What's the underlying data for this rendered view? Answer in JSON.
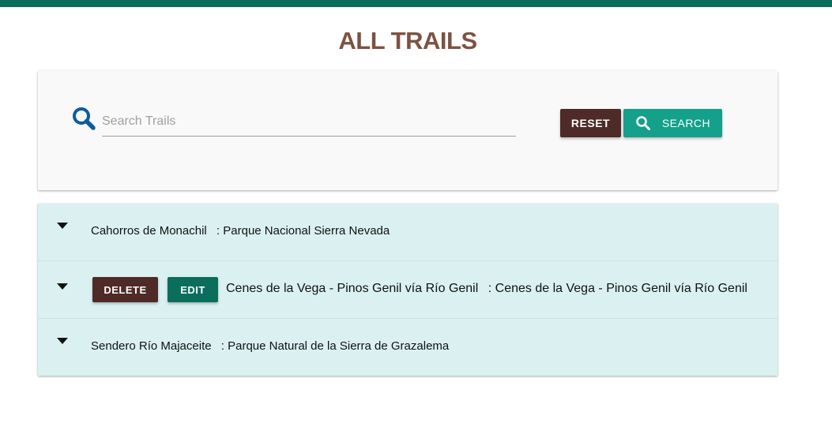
{
  "page": {
    "title": "ALL TRAILS",
    "colors": {
      "topbar": "#0b6e5c",
      "title": "#7d5242",
      "reset_button": "#4e2b26",
      "search_button": "#14a08a",
      "delete_button": "#4e2b26",
      "edit_button": "#0b6e5c",
      "list_background": "#dbf1f1",
      "search_icon": "#0d5c9e"
    }
  },
  "search": {
    "icon": "search-icon",
    "placeholder": "Search Trails",
    "value": "",
    "reset_label": "RESET",
    "search_label": "SEARCH",
    "search_button_icon": "search-icon"
  },
  "trails": [
    {
      "name": "Cahorros de Monachil",
      "separator": ":",
      "location": "Parque Nacional Sierra Nevada",
      "expand_icon": "caret-down-icon",
      "actions_visible": false
    },
    {
      "name": "Cenes de la Vega - Pinos Genil vía Río Genil",
      "separator": ":",
      "location": "Cenes de la Vega - Pinos Genil vía Río Genil",
      "expand_icon": "caret-down-icon",
      "actions_visible": true,
      "delete_label": "DELETE",
      "edit_label": "EDIT"
    },
    {
      "name": "Sendero Río Majaceite",
      "separator": ":",
      "location": "Parque Natural de la Sierra de Grazalema",
      "expand_icon": "caret-down-icon",
      "actions_visible": false
    }
  ]
}
